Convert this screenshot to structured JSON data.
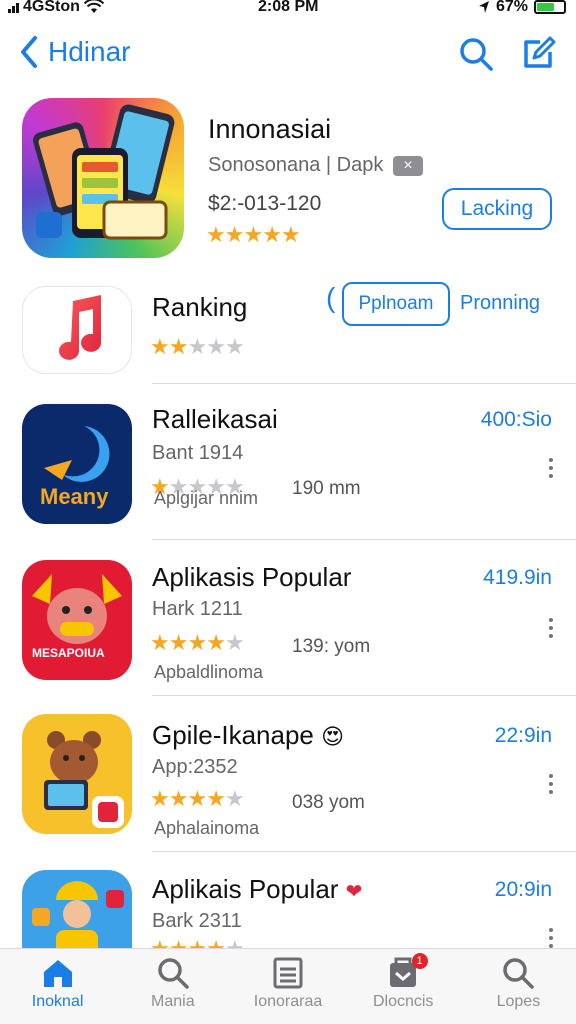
{
  "status_bar": {
    "carrier": "4GSton",
    "time": "2:08 PM",
    "battery": "67%"
  },
  "nav": {
    "back_label": "Hdinar"
  },
  "featured": {
    "title": "Innonasiai",
    "subtitle": "Sonosonana | Dapk",
    "chip": "×",
    "meta": "$2:-013-120",
    "rating": 4.5,
    "button_label": "Lacking"
  },
  "ranking_row": {
    "title": "Ranking",
    "rating": 2,
    "pill_label": "Pplnoam",
    "link_label": "Pronning"
  },
  "apps": [
    {
      "title": "Ralleikasai",
      "subtitle": "Bant 1914",
      "rating": 1,
      "count": "190 mm",
      "category": "Aplgijar nnim",
      "price": "400:Sio",
      "icon_text": "Meany"
    },
    {
      "title": "Aplikasis Popular",
      "subtitle": "Hark 1211",
      "rating": 4,
      "count": "139: yom",
      "category": "Apbaldlinoma",
      "price": "419.9in",
      "icon_text": "MESAPOIUA"
    },
    {
      "title": "Gpile-Ikanape",
      "subtitle": "App:2352",
      "rating": 4,
      "count": "038 yom",
      "category": "Aphalainoma",
      "price": "22:9in",
      "emoji": "😍"
    },
    {
      "title": "Aplikais Popular",
      "subtitle": "Bark 2311",
      "rating": 4,
      "price": "20:9in",
      "emoji": "❤"
    }
  ],
  "tabs": [
    {
      "label": "Inoknal",
      "icon": "home-icon",
      "active": true
    },
    {
      "label": "Mania",
      "icon": "search-icon",
      "active": false
    },
    {
      "label": "Ionoraraa",
      "icon": "list-icon",
      "active": false
    },
    {
      "label": "Dlocncis",
      "icon": "inbox-icon",
      "active": false,
      "badge": "1"
    },
    {
      "label": "Lopes",
      "icon": "search-icon",
      "active": false
    }
  ],
  "colors": {
    "accent": "#1a7ee6",
    "star": "#f5a623",
    "badge": "#e0242c"
  }
}
